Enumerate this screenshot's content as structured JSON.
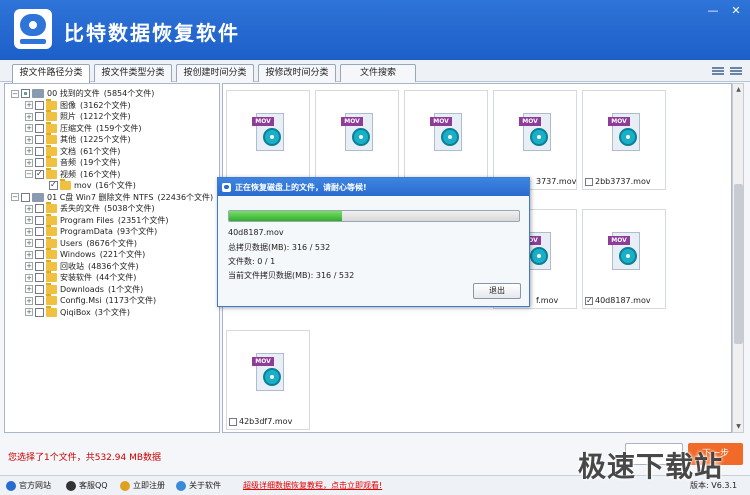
{
  "header": {
    "title": "比特数据恢复软件",
    "min": "—",
    "close": "✕"
  },
  "tabs": [
    {
      "label": "按文件路径分类"
    },
    {
      "label": "按文件类型分类"
    },
    {
      "label": "按创建时间分类"
    },
    {
      "label": "按修改时间分类"
    },
    {
      "label": "文件搜索"
    }
  ],
  "tree": {
    "items": [
      {
        "label": "00 找到的文件",
        "count": "(5854个文件)"
      },
      {
        "label": "图像",
        "count": "(3162个文件)"
      },
      {
        "label": "照片",
        "count": "(1212个文件)"
      },
      {
        "label": "压缩文件",
        "count": "(159个文件)"
      },
      {
        "label": "其他",
        "count": "(1225个文件)"
      },
      {
        "label": "文档",
        "count": "(61个文件)"
      },
      {
        "label": "音频",
        "count": "(19个文件)"
      },
      {
        "label": "视频",
        "count": "(16个文件)"
      },
      {
        "label": "mov",
        "count": "(16个文件)"
      },
      {
        "label": "01 C盘 Win7 删除文件 NTFS",
        "count": "(22436个文件)"
      },
      {
        "label": "丢失的文件",
        "count": "(5038个文件)"
      },
      {
        "label": "Program Files",
        "count": "(2351个文件)"
      },
      {
        "label": "ProgramData",
        "count": "(93个文件)"
      },
      {
        "label": "Users",
        "count": "(8676个文件)"
      },
      {
        "label": "Windows",
        "count": "(221个文件)"
      },
      {
        "label": "回收站",
        "count": "(4836个文件)"
      },
      {
        "label": "安装软件",
        "count": "(44个文件)"
      },
      {
        "label": "Downloads",
        "count": "(1个文件)"
      },
      {
        "label": "Config.Msi",
        "count": "(1173个文件)"
      },
      {
        "label": "QiqiBox",
        "count": "(3个文件)"
      }
    ]
  },
  "files": [
    {
      "name": ""
    },
    {
      "name": ""
    },
    {
      "name": ""
    },
    {
      "name": "3737.mov"
    },
    {
      "name": "2bb3737.mov"
    },
    {
      "name": "f.mov"
    },
    {
      "name": "40d8187.mov"
    },
    {
      "name": "42b3df7.mov"
    }
  ],
  "mov_tag": "MOV",
  "dialog": {
    "title": "正在恢复磁盘上的文件，请耐心等候!",
    "progress": 0.39,
    "current_file": "40d8187.mov",
    "total_label": "总拷贝数据(MB):",
    "total_value": "316 / 532",
    "files_label": "文件数:",
    "files_value": "0 / 1",
    "current_label": "当前文件拷贝数据(MB):",
    "current_value": "316 / 532",
    "exit_label": "退出"
  },
  "status": {
    "message": "您选择了1个文件，共532.94 MB数据"
  },
  "buttons": {
    "next": "下一步"
  },
  "footer": {
    "site": "官方网站",
    "qq": "客服QQ",
    "register": "立即注册",
    "about": "关于软件",
    "promo": "超级详细数据恢复教程，点击立即观看!",
    "version_label": "版本:",
    "version_value": "V6.3.1"
  },
  "watermark": "极速下载站",
  "colors": {
    "header": "#1c5fc9",
    "accent_red": "#cc0000",
    "next_button": "#f06a2a",
    "progress": "#2fae2a"
  }
}
